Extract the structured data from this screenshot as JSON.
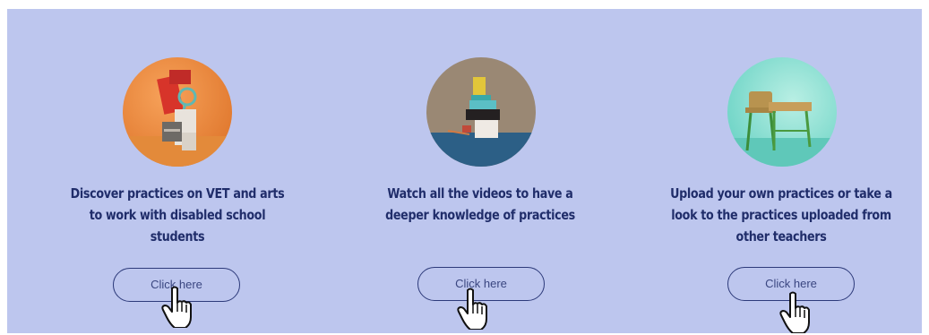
{
  "cards": [
    {
      "thumbnail_icon": "art-supplies-still-life-image",
      "title_lines": [
        "Discover practices on VET and arts",
        "to work with disabled school",
        "students"
      ],
      "button_label": "Click here"
    },
    {
      "thumbnail_icon": "stacked-books-and-pencil-cup-image",
      "title_lines": [
        "Watch all the videos to have a",
        "deeper knowledge of practices"
      ],
      "button_label": "Click here"
    },
    {
      "thumbnail_icon": "miniature-school-desk-and-chair-image",
      "title_lines": [
        "Upload your own practices or take a",
        "look to the practices uploaded from",
        "other teachers"
      ],
      "button_label": "Click here"
    }
  ],
  "colors": {
    "background": "#bdc6ee",
    "title_text": "#202d6a",
    "button_border": "#2d3a7a"
  }
}
